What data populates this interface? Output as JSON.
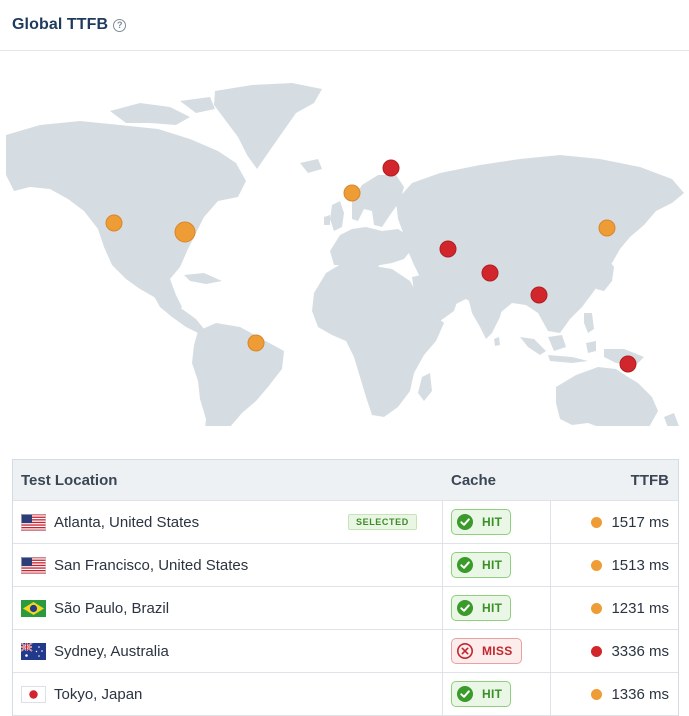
{
  "header": {
    "title": "Global TTFB",
    "help_icon": "?"
  },
  "colors": {
    "fast": "#ee9c36",
    "slow": "#d1262b",
    "land": "#d5dde2"
  },
  "map": {
    "markers": [
      {
        "name": "marker-atlanta",
        "status": "fast",
        "selected": true
      },
      {
        "name": "marker-san-francisco",
        "status": "fast"
      },
      {
        "name": "marker-sao-paulo",
        "status": "fast"
      },
      {
        "name": "marker-sydney",
        "status": "slow"
      },
      {
        "name": "marker-tokyo",
        "status": "fast"
      },
      {
        "name": "marker-london",
        "status": "fast"
      },
      {
        "name": "marker-stockholm",
        "status": "slow"
      },
      {
        "name": "marker-dubai",
        "status": "slow"
      },
      {
        "name": "marker-bangalore",
        "status": "slow"
      },
      {
        "name": "marker-singapore",
        "status": "slow"
      }
    ]
  },
  "table": {
    "headers": {
      "location": "Test Location",
      "cache": "Cache",
      "ttfb": "TTFB"
    },
    "selected_label": "SELECTED",
    "rows": [
      {
        "flag": "us-flag-icon",
        "location": "Atlanta, United States",
        "cache": "HIT",
        "status": "fast",
        "ttfb": "1517 ms"
      },
      {
        "flag": "us-flag-icon",
        "location": "San Francisco, United States",
        "cache": "HIT",
        "status": "fast",
        "ttfb": "1513 ms"
      },
      {
        "flag": "brazil-flag-icon",
        "location": "São Paulo, Brazil",
        "cache": "HIT",
        "status": "fast",
        "ttfb": "1231 ms"
      },
      {
        "flag": "australia-flag-icon",
        "location": "Sydney, Australia",
        "cache": "MISS",
        "status": "slow",
        "ttfb": "3336 ms"
      },
      {
        "flag": "japan-flag-icon",
        "location": "Tokyo, Japan",
        "cache": "HIT",
        "status": "fast",
        "ttfb": "1336 ms"
      }
    ]
  }
}
